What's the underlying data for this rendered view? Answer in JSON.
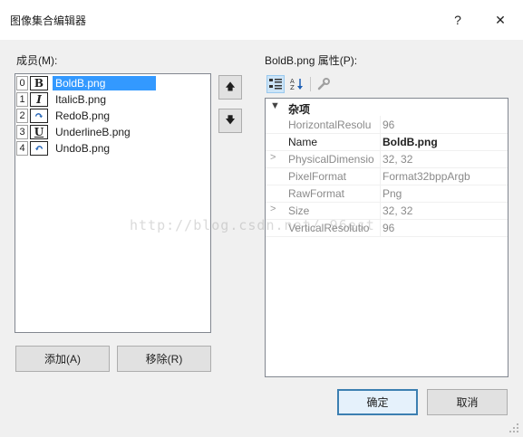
{
  "window": {
    "title": "图像集合编辑器",
    "help": "?",
    "close": "✕"
  },
  "members": {
    "label": "成员(M):",
    "items": [
      {
        "index": "0",
        "glyph": "B",
        "name": "BoldB.png",
        "selected": true
      },
      {
        "index": "1",
        "glyph": "I",
        "name": "ItalicB.png",
        "selected": false
      },
      {
        "index": "2",
        "glyph": "↶",
        "name": "RedoB.png",
        "selected": false
      },
      {
        "index": "3",
        "glyph": "U",
        "name": "UnderlineB.png",
        "selected": false
      },
      {
        "index": "4",
        "glyph": "↶",
        "name": "UndoB.png",
        "selected": false
      }
    ],
    "move_up": "🡅",
    "move_down": "🡇",
    "add_label": "添加(A)",
    "remove_label": "移除(R)"
  },
  "properties": {
    "label": "BoldB.png 属性(P):",
    "category": "杂项",
    "rows": [
      {
        "name": "HorizontalResolu",
        "value": "96",
        "expandable": false,
        "active": false
      },
      {
        "name": "Name",
        "value": "BoldB.png",
        "expandable": false,
        "active": true
      },
      {
        "name": "PhysicalDimensio",
        "value": "32, 32",
        "expandable": true,
        "active": false
      },
      {
        "name": "PixelFormat",
        "value": "Format32bppArgb",
        "expandable": false,
        "active": false
      },
      {
        "name": "RawFormat",
        "value": "Png",
        "expandable": false,
        "active": false
      },
      {
        "name": "Size",
        "value": "32, 32",
        "expandable": true,
        "active": false
      },
      {
        "name": "VerticalResolutio",
        "value": "96",
        "expandable": false,
        "active": false
      }
    ]
  },
  "footer": {
    "ok_label": "确定",
    "cancel_label": "取消"
  },
  "watermark": "http://blog.csdn.net/   96est",
  "colors": {
    "selection": "#3399ff",
    "primary_border": "#3c7fb1",
    "background": "#f0f0f0"
  }
}
